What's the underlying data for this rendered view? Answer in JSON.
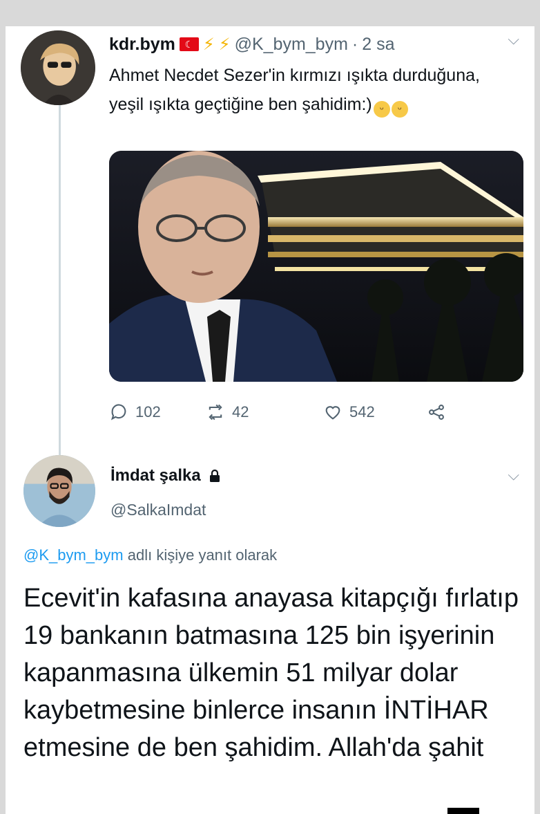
{
  "tweet1": {
    "display_name": "kdr.bym",
    "badges": [
      "turkey-flag-icon",
      "lightning-icon",
      "lightning-icon"
    ],
    "handle": "@K_bym_bym",
    "separator": "·",
    "time": "2 sa",
    "text": "Ahmet Necdet Sezer'in kırmızı ışıkta durduğuna, yeşil ışıkta geçtiğine ben şahidim:)",
    "emojis": [
      "grinning-face-icon",
      "grinning-face-icon"
    ],
    "stats": {
      "replies": "102",
      "retweets": "42",
      "likes": "542"
    }
  },
  "tweet2": {
    "display_name": "İmdat şalka",
    "handle": "@SalkaImdat",
    "reply_mention": "@K_bym_bym",
    "reply_suffix": "adlı kişiye yanıt olarak",
    "text": "Ecevit'in kafasına anayasa kitapçığı fırlatıp 19 bankanın batmasına 125 bin işyerinin kapanmasına ülkemin 51 milyar dolar kaybetmesine binlerce insanın İNTİHAR etmesine de ben şahidim. Allah'da şahit"
  },
  "colors": {
    "background": "#d9d9d9",
    "card": "#ffffff",
    "secondary_text": "#536471",
    "link": "#1d9bf0",
    "flag_red": "#e30a17"
  }
}
